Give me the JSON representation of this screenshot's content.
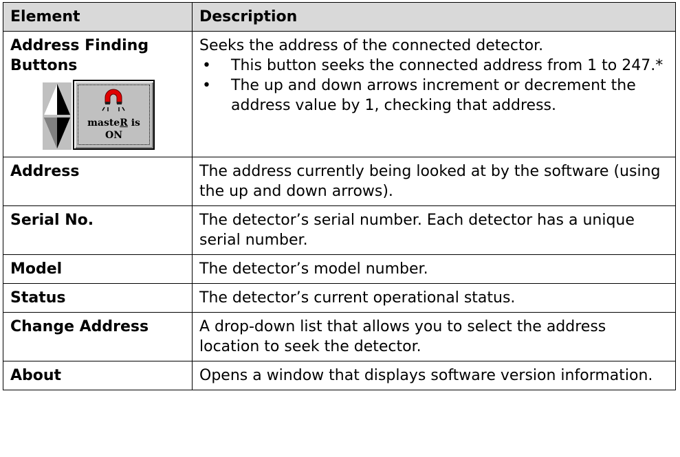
{
  "table": {
    "headers": {
      "element": "Element",
      "description": "Description"
    },
    "rows": [
      {
        "element": "Address Finding Buttons",
        "description": "Seeks the address of the connected detector.",
        "bullets": [
          "This button seeks the connected address from 1 to 247.*",
          "The up and down arrows increment or decrement the address value by 1, checking that address."
        ],
        "button_image": {
          "icons": [
            "arrow-up-icon",
            "arrow-down-icon",
            "magnet-icon"
          ],
          "label_before": "maste",
          "label_underlined": "R",
          "label_after": " is",
          "label_line2": "ON"
        }
      },
      {
        "element": "Address",
        "description": "The address currently being looked at by the software (using the up and down arrows)."
      },
      {
        "element": "Serial No.",
        "description": "The detector’s serial number. Each detector has a unique serial number."
      },
      {
        "element": "Model",
        "description": "The detector’s model number."
      },
      {
        "element": "Status",
        "description": "The detector’s current operational status."
      },
      {
        "element": "Change Address",
        "description": "A drop-down list that allows you to select the address location to seek the detector."
      },
      {
        "element": "About",
        "description": "Opens a window that displays software version information."
      }
    ]
  },
  "colors": {
    "header_bg": "#d9d9d9",
    "button_face": "#c0c0c0",
    "magnet_red": "#e00000"
  }
}
